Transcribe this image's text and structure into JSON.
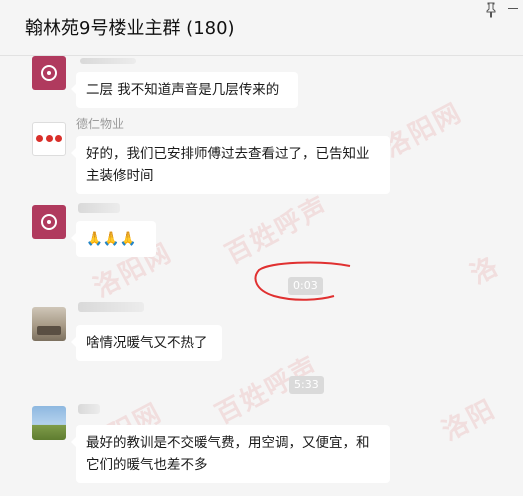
{
  "header": {
    "title": "翰林苑9号楼业主群 (180)"
  },
  "messages": [
    {
      "sender": "",
      "text": "二层 我不知道声音是几层传来的",
      "avatar": "maroon-cup-avatar"
    },
    {
      "sender": "德仁物业",
      "text": "好的，我们已安排师傅过去查看过了，已告知业主装修时间",
      "avatar": "red-logo-avatar"
    },
    {
      "sender": "",
      "text": "🙏🙏🙏",
      "avatar": "maroon-cup-avatar"
    },
    {
      "sender": "",
      "text": "啥情况暖气又不热了",
      "avatar": "living-room-avatar"
    },
    {
      "sender": "",
      "text": "最好的教训是不交暖气费，用空调，又便宜，和它们的暖气也差不多",
      "avatar": "field-landscape-avatar"
    }
  ],
  "timestamps": [
    "0:03",
    "5:33"
  ],
  "watermark": "洛阳网 百姓呼声",
  "colors": {
    "background": "#f5f5f5",
    "bubble": "#ffffff",
    "annotation": "#e03030"
  }
}
